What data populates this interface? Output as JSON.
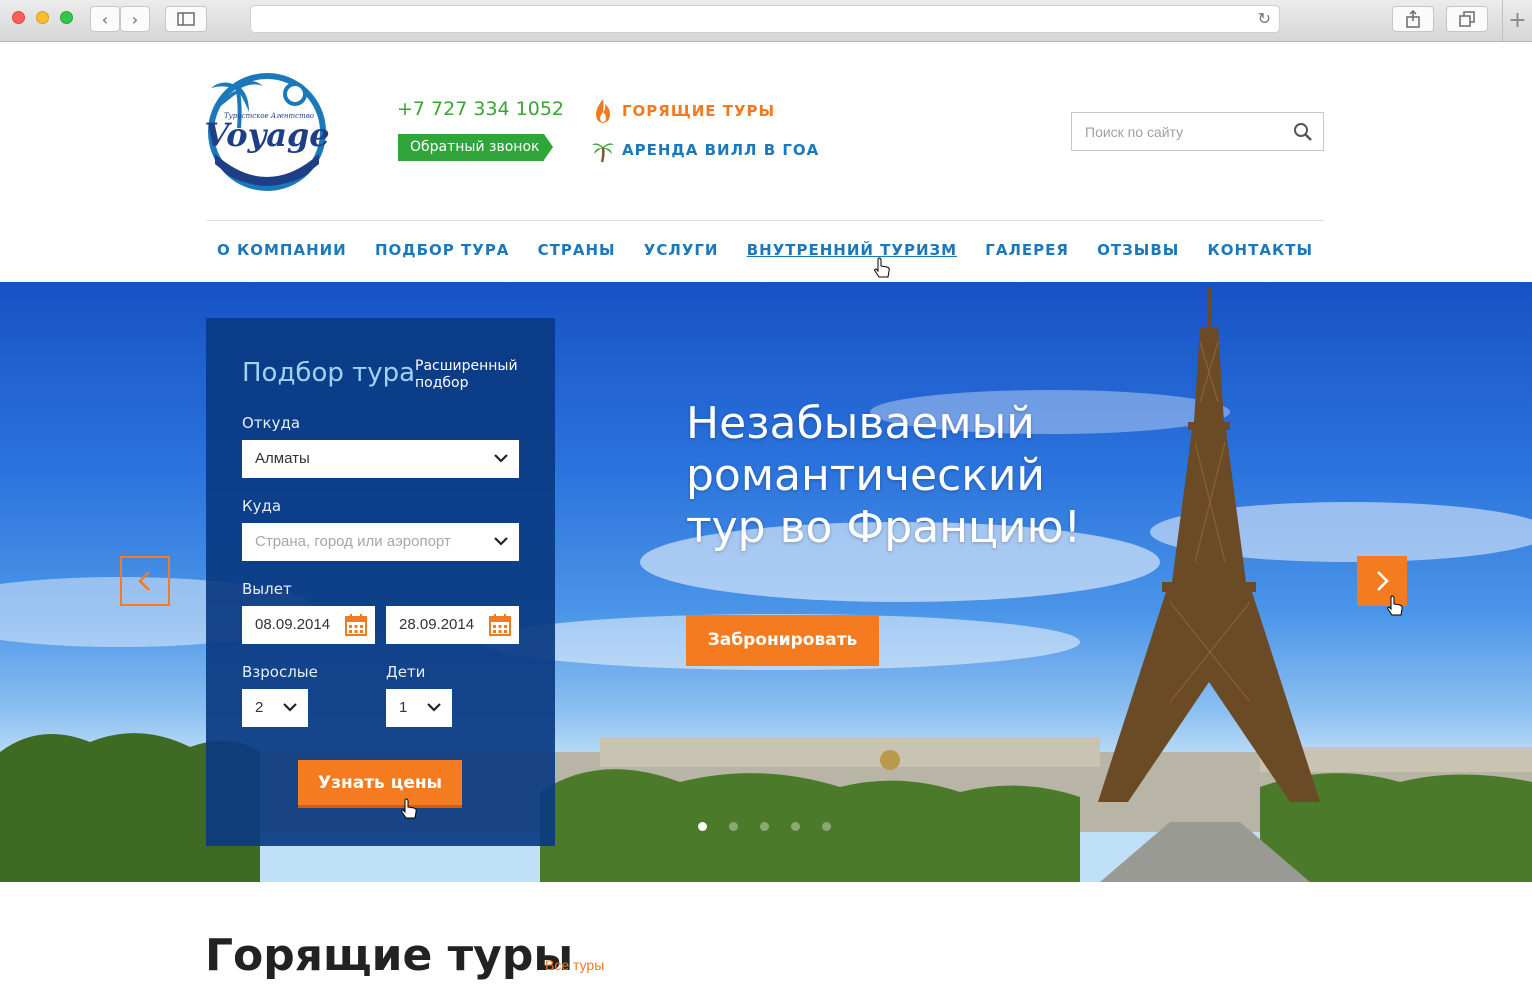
{
  "browser": {
    "address": "",
    "back_glyph": "‹",
    "forward_glyph": "›",
    "new_tab_glyph": "+"
  },
  "header": {
    "logo": {
      "name": "Voyage",
      "tagline": "Туристское Агентство"
    },
    "phone": "+7 727 334 1052",
    "callback_label": "Обратный звонок",
    "hot_tours": "ГОРЯЩИЕ ТУРЫ",
    "villa_rent": "АРЕНДА ВИЛЛ В ГОА",
    "search_placeholder": "Поиск по сайту"
  },
  "nav": [
    {
      "label": "О КОМПАНИИ"
    },
    {
      "label": "ПОДБОР ТУРА"
    },
    {
      "label": "СТРАНЫ"
    },
    {
      "label": "УСЛУГИ"
    },
    {
      "label": "ВНУТРЕННИЙ ТУРИЗМ",
      "active": true
    },
    {
      "label": "ГАЛЕРЕЯ"
    },
    {
      "label": "ОТЗЫВЫ"
    },
    {
      "label": "КОНТАКТЫ"
    }
  ],
  "tour_form": {
    "title": "Подбор тура",
    "advanced_link": "Расширенный подбор",
    "from_label": "Откуда",
    "from_value": "Алматы",
    "to_label": "Куда",
    "to_placeholder": "Страна, город или аэропорт",
    "departure_label": "Вылет",
    "date_from": "08.09.2014",
    "date_to": "28.09.2014",
    "adults_label": "Взрослые",
    "adults_value": "2",
    "children_label": "Дети",
    "children_value": "1",
    "submit_label": "Узнать цены"
  },
  "hero": {
    "headline_line1": "Незабываемый",
    "headline_line2": "романтический",
    "headline_line3": "тур во Францию!",
    "cta_label": "Забронировать",
    "slide_count": 5,
    "active_slide": 1
  },
  "section": {
    "title": "Горящие туры",
    "all_link": "Все туры"
  },
  "colors": {
    "brand_blue": "#1a78bb",
    "accent_orange": "#f47b20",
    "green": "#2fa53a",
    "panel_blue": "#0a3a82"
  }
}
